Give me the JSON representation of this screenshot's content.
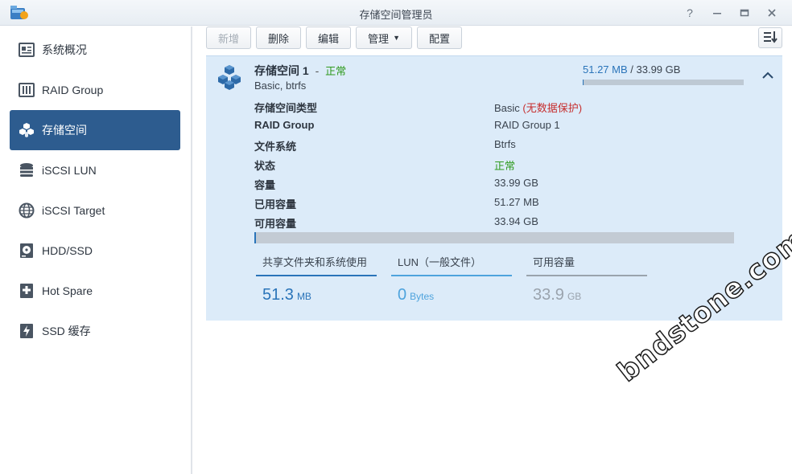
{
  "window": {
    "title": "存储空间管理员"
  },
  "sidebar": {
    "items": [
      {
        "label": "系统概况",
        "icon": "overview-icon"
      },
      {
        "label": "RAID Group",
        "icon": "raid-icon"
      },
      {
        "label": "存储空间",
        "icon": "volume-cubes-icon",
        "active": true
      },
      {
        "label": "iSCSI LUN",
        "icon": "database-icon"
      },
      {
        "label": "iSCSI Target",
        "icon": "globe-icon"
      },
      {
        "label": "HDD/SSD",
        "icon": "disk-icon"
      },
      {
        "label": "Hot Spare",
        "icon": "plus-box-icon"
      },
      {
        "label": "SSD 缓存",
        "icon": "lightning-icon"
      }
    ]
  },
  "toolbar": {
    "create_label": "新增",
    "delete_label": "删除",
    "edit_label": "编辑",
    "manage_label": "管理",
    "config_label": "配置"
  },
  "volume": {
    "name": "存储空间 1",
    "separator": "-",
    "status": "正常",
    "subtitle": "Basic, btrfs",
    "used": "51.27 MB",
    "usage_sep": " / ",
    "total": "33.99 GB",
    "usage_fraction": 0.0015,
    "details": [
      {
        "label": "存储空间类型",
        "value": "Basic",
        "note": "(无数据保护)"
      },
      {
        "label": "RAID Group",
        "value": "RAID Group 1"
      },
      {
        "label": "文件系统",
        "value": "Btrfs"
      },
      {
        "label": "状态",
        "value": "正常",
        "status": "ok"
      },
      {
        "label": "容量",
        "value": "33.99 GB"
      },
      {
        "label": "已用容量",
        "value": "51.27 MB"
      },
      {
        "label": "可用容量",
        "value": "33.94 GB"
      }
    ],
    "breakdown": [
      {
        "title": "共享文件夹和系统使用",
        "value": "51.3",
        "unit": "MB",
        "color": "#2a74b9"
      },
      {
        "title": "LUN（一般文件）",
        "value": "0",
        "unit": "Bytes",
        "color": "#4ea3dd"
      },
      {
        "title": "可用容量",
        "value": "33.9",
        "unit": "GB",
        "color": "#9aa3ad"
      }
    ]
  },
  "watermark": "bndstone.com",
  "colors": {
    "accent": "#2d5c8f",
    "panel": "#dcebf9",
    "ok": "#2f9a1e",
    "warn": "#c62e2e"
  }
}
